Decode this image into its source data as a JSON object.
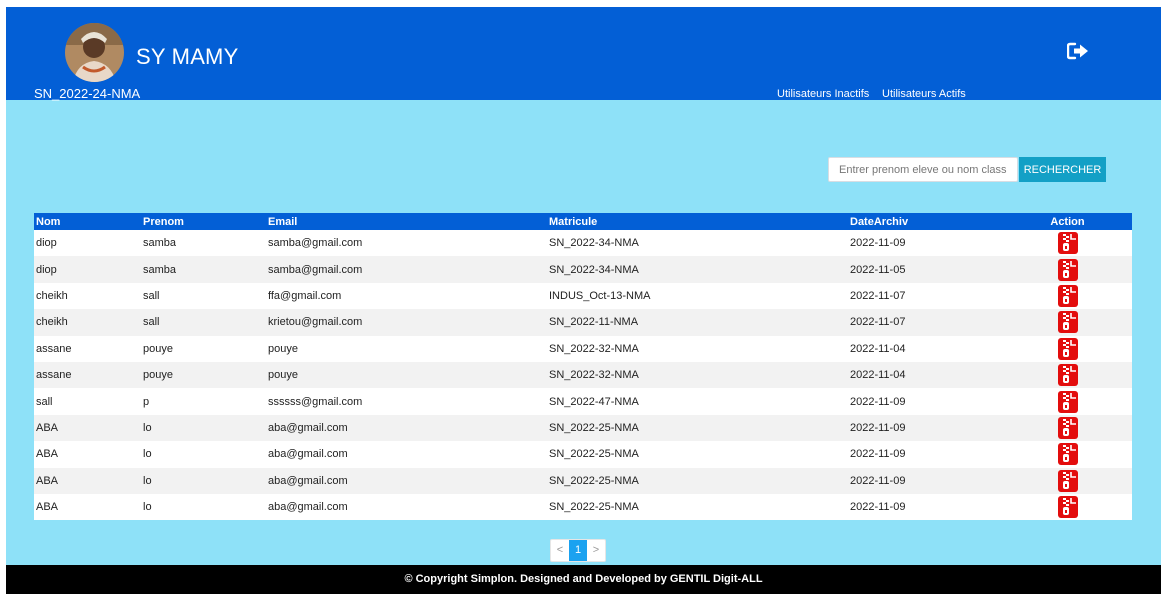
{
  "header": {
    "user_name": "SY MAMY",
    "user_code": "SN_2022-24-NMA",
    "nav": {
      "inactive_users": "Utilisateurs Inactifs",
      "active_users": "Utilisateurs Actifs"
    },
    "logout_icon": "sign-out-icon"
  },
  "search": {
    "placeholder": "Entrer prenom eleve ou nom classe",
    "value": "",
    "button_label": "RECHERCHER"
  },
  "table": {
    "columns": [
      "Nom",
      "Prenom",
      "Email",
      "Matricule",
      "DateArchiv",
      "Action"
    ],
    "rows": [
      {
        "nom": "diop",
        "prenom": "samba",
        "email": "samba@gmail.com",
        "matricule": "SN_2022-34-NMA",
        "date": "2022-11-09"
      },
      {
        "nom": "diop",
        "prenom": "samba",
        "email": "samba@gmail.com",
        "matricule": "SN_2022-34-NMA",
        "date": "2022-11-05"
      },
      {
        "nom": "cheikh",
        "prenom": "sall",
        "email": "ffa@gmail.com",
        "matricule": "INDUS_Oct-13-NMA",
        "date": "2022-11-07"
      },
      {
        "nom": "cheikh",
        "prenom": "sall",
        "email": "krietou@gmail.com",
        "matricule": "SN_2022-11-NMA",
        "date": "2022-11-07"
      },
      {
        "nom": "assane",
        "prenom": "pouye",
        "email": "pouye",
        "matricule": "SN_2022-32-NMA",
        "date": "2022-11-04"
      },
      {
        "nom": "assane",
        "prenom": "pouye",
        "email": "pouye",
        "matricule": "SN_2022-32-NMA",
        "date": "2022-11-04"
      },
      {
        "nom": "sall",
        "prenom": "p",
        "email": "ssssss@gmail.com",
        "matricule": "SN_2022-47-NMA",
        "date": "2022-11-09"
      },
      {
        "nom": "ABA",
        "prenom": "lo",
        "email": "aba@gmail.com",
        "matricule": "SN_2022-25-NMA",
        "date": "2022-11-09"
      },
      {
        "nom": "ABA",
        "prenom": "lo",
        "email": "aba@gmail.com",
        "matricule": "SN_2022-25-NMA",
        "date": "2022-11-09"
      },
      {
        "nom": "ABA",
        "prenom": "lo",
        "email": "aba@gmail.com",
        "matricule": "SN_2022-25-NMA",
        "date": "2022-11-09"
      },
      {
        "nom": "ABA",
        "prenom": "lo",
        "email": "aba@gmail.com",
        "matricule": "SN_2022-25-NMA",
        "date": "2022-11-09"
      }
    ],
    "action_icon": "unarchive-zip-icon",
    "action_color": "#e30d0d"
  },
  "pagination": {
    "prev": "<",
    "current": "1",
    "next": ">"
  },
  "footer": {
    "text": "© Copyright Simplon. Designed and Developed by GENTIL Digit-ALL"
  },
  "colors": {
    "header_bg": "#035fd6",
    "page_bg": "#8ee1f8",
    "search_button_bg": "#13a0c6",
    "footer_bg": "#000000"
  }
}
